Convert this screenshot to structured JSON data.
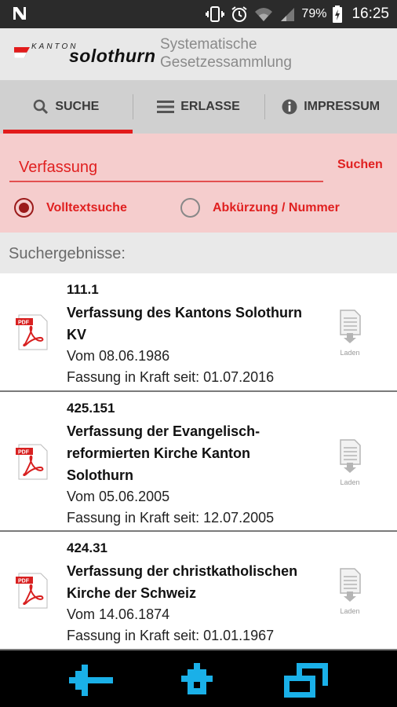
{
  "statusbar": {
    "battery": "79%",
    "time": "16:25"
  },
  "header": {
    "logo_kanton": "KANTON",
    "logo_name": "solothurn",
    "subtitle_line1": "Systematische",
    "subtitle_line2": "Gesetzessammlung"
  },
  "tabs": [
    {
      "label": "SUCHE",
      "icon": "search-icon",
      "active": true
    },
    {
      "label": "ERLASSE",
      "icon": "list-icon",
      "active": false
    },
    {
      "label": "IMPRESSUM",
      "icon": "info-icon",
      "active": false
    }
  ],
  "search": {
    "value": "Verfassung",
    "button_label": "Suchen",
    "options": [
      {
        "label": "Volltextsuche",
        "checked": true
      },
      {
        "label": "Abkürzung / Nummer",
        "checked": false
      }
    ]
  },
  "results": {
    "title": "Suchergebnisse:",
    "download_label": "Laden",
    "items": [
      {
        "number": "111.1",
        "title": "Verfassung des Kantons Solothurn KV",
        "date": "Vom 08.06.1986",
        "fassung": "Fassung in Kraft seit: 01.07.2016"
      },
      {
        "number": "425.151",
        "title": "Verfassung der Evangelisch-reformierten Kirche Kanton Solothurn",
        "date": "Vom 05.06.2005",
        "fassung": "Fassung in Kraft seit: 12.07.2005"
      },
      {
        "number": "424.31",
        "title": "Verfassung der christkatholischen Kirche der Schweiz",
        "date": "Vom 14.06.1874",
        "fassung": "Fassung in Kraft seit: 01.01.1967"
      }
    ]
  },
  "colors": {
    "accent": "#e21b1b",
    "search_panel_bg": "#f5cdcd",
    "nav_icon": "#1ab0e8"
  }
}
